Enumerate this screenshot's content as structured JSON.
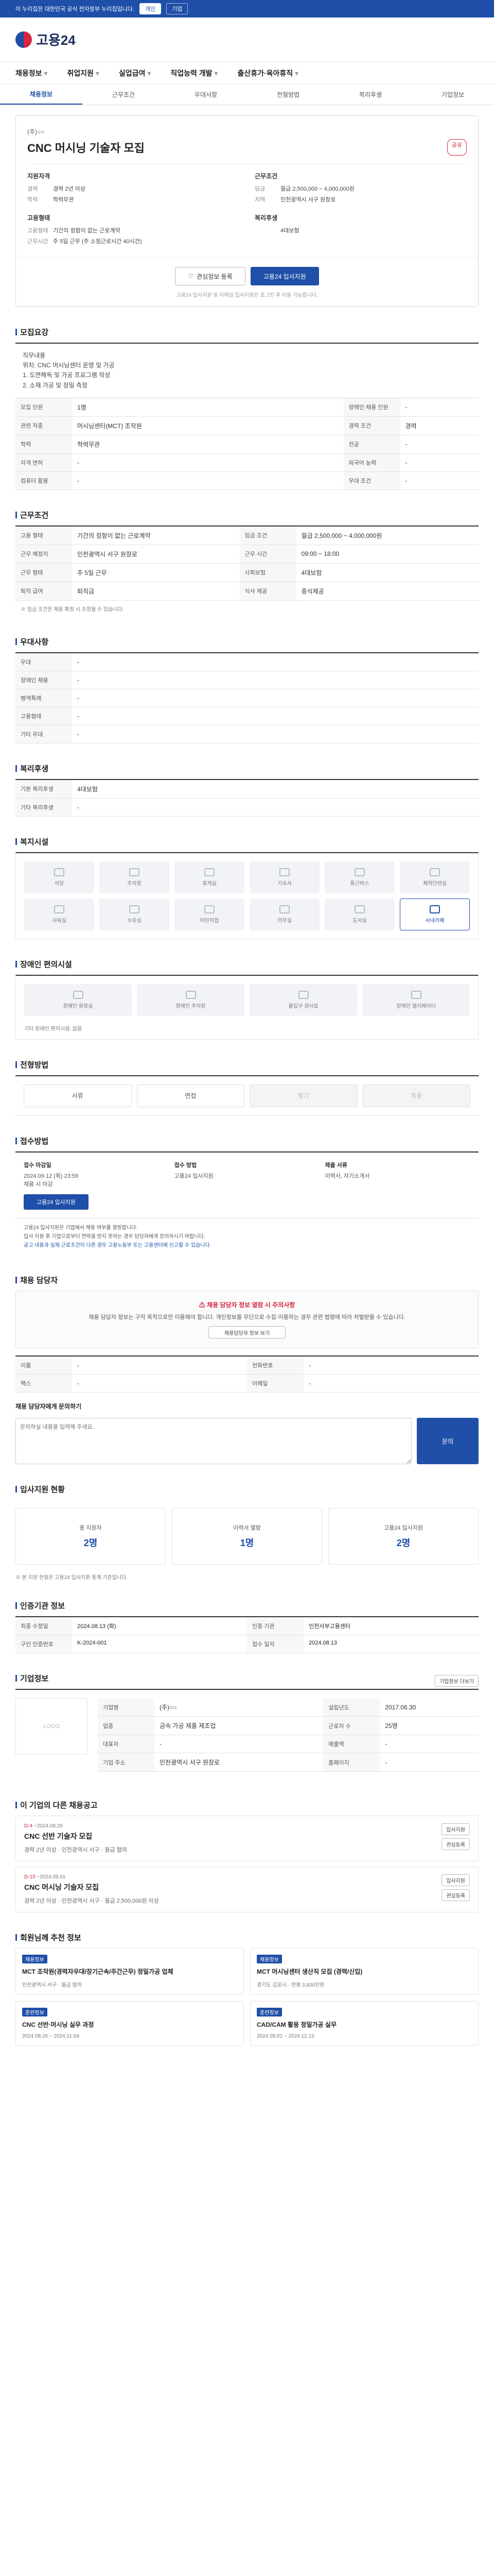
{
  "topbar": {
    "notice": "이 누리집은 대한민국 공식 전자정부 누리집입니다.",
    "tabs": [
      "개인",
      "기업"
    ]
  },
  "header": {
    "logo": "고용24"
  },
  "gnb": [
    "채용정보",
    "취업지원",
    "실업급여",
    "직업능력 개발",
    "출산휴가·육아휴직"
  ],
  "subtabs": [
    "채용정보",
    "근무조건",
    "우대사항",
    "전형방법",
    "복리후생",
    "기업정보"
  ],
  "job": {
    "company": "(주)○○",
    "title": "CNC 머시닝 기술자 모집",
    "share": "공유",
    "qual_title": "지원자격",
    "qual": [
      {
        "k": "경력",
        "v": "경력 2년 이상"
      },
      {
        "k": "학력",
        "v": "학력무관"
      }
    ],
    "cond_title": "근무조건",
    "cond": [
      {
        "k": "임금",
        "v": "월급 2,500,000 ~ 4,000,000원"
      },
      {
        "k": "지역",
        "v": "인천광역시 서구 원창로"
      }
    ],
    "form_title": "고용형태",
    "form": [
      {
        "k": "고용형태",
        "v": "기간의 정함이 없는 근로계약"
      },
      {
        "k": "근무시간",
        "v": "주 5일 근무 (주 소정근로시간 40시간)"
      }
    ],
    "welfare_title": "복리후생",
    "welfare": [
      {
        "k": "",
        "v": "4대보험"
      }
    ],
    "btn_interest": "관심정보 등록",
    "btn_apply": "고용24 입사지원",
    "note": "고용24 입사지원 및 이메일 입사지원은 로그인 후 이용 가능합니다."
  },
  "sec_recruit": {
    "title": "모집요강",
    "desc": "직무내용\n위치: CNC 머시닝센터 운영 및 가공\n1. 도면해독 및 가공 프로그램 작성\n2. 소재 가공 및 정밀 측정",
    "rows": [
      [
        "모집 인원",
        "1명",
        "장애인 채용 인원",
        "-"
      ],
      [
        "관련 직종",
        "머시닝센터(MCT) 조작원",
        "경력 조건",
        "경력"
      ],
      [
        "학력",
        "학력무관",
        "전공",
        "-"
      ],
      [
        "자격 면허",
        "-",
        "외국어 능력",
        "-"
      ],
      [
        "컴퓨터 활용",
        "-",
        "우대 조건",
        "-"
      ]
    ]
  },
  "sec_cond": {
    "title": "근무조건",
    "rows": [
      [
        "고용 형태",
        "기간의 정함이 없는 근로계약",
        "임금 조건",
        "월급 2,500,000 ~ 4,000,000원"
      ],
      [
        "근무 예정지",
        "인천광역시 서구 원창로",
        "근무 시간",
        "09:00 ~ 18:00"
      ],
      [
        "근무 형태",
        "주 5일 근무",
        "사회보험",
        "4대보험"
      ],
      [
        "퇴직 급여",
        "퇴직금",
        "식사 제공",
        "중식제공"
      ]
    ],
    "footnote": "※ 임금 조건은 채용 확정 시 조정될 수 있습니다."
  },
  "sec_pref": {
    "title": "우대사항",
    "rows": [
      [
        "우대",
        "-"
      ],
      [
        "장애인 채용",
        "-"
      ],
      [
        "병역특례",
        "-"
      ],
      [
        "고용형태",
        "-"
      ],
      [
        "기타 우대",
        "-"
      ]
    ]
  },
  "sec_welfare": {
    "title": "복리후생",
    "rows": [
      [
        "기본 복리후생",
        "4대보험"
      ],
      [
        "기타 복리후생",
        "-"
      ]
    ]
  },
  "sec_facility": {
    "title": "복지시설",
    "items": [
      "식당",
      "주차장",
      "휴게실",
      "기숙사",
      "통근버스",
      "체력단련실",
      "샤워실",
      "수유실",
      "어린이집",
      "의무실",
      "도서실",
      "사내카페"
    ]
  },
  "sec_disabled": {
    "title": "장애인 편의시설",
    "items": [
      "장애인 화장실",
      "장애인 주차장",
      "출입구 경사로",
      "장애인 엘리베이터"
    ],
    "note": "기타 장애인 편의시설: 없음"
  },
  "sec_process": {
    "title": "전형방법",
    "rows": [
      [
        "전형 방법",
        "서류",
        "면접"
      ],
      [
        "제출 서류",
        "이력서",
        "-"
      ]
    ],
    "steps": [
      "서류",
      "면접",
      "필기",
      "최종"
    ],
    "steps_off": [
      false,
      false,
      true,
      true
    ]
  },
  "sec_apply": {
    "title": "접수방법",
    "col1_h": "접수 마감일",
    "col1_v": "2024.09.12 (목) 23:59",
    "col1_note": "채용 시 마감",
    "col2_h": "접수 방법",
    "col2_v": "고용24 입사지원",
    "col3_h": "제출 서류",
    "col3_v": "이력서, 자기소개서",
    "apply_btn": "고용24 입사지원",
    "bullets": [
      "고용24 입사지원은 기업에서 채용 여부를 결정합니다.",
      "입사 지원 후 기업으로부터 연락을 받지 못하는 경우 담당자에게 문의하시기 바랍니다.",
      "공고 내용과 실제 근로조건이 다른 경우 고용노동부 또는 고용센터에 신고할 수 있습니다."
    ]
  },
  "sec_contact": {
    "title": "채용 담당자",
    "warn": "채용 담당자 정보 열람 시 주의사항",
    "warntext": "채용 담당자 정보는 구직 목적으로만 이용해야 합니다. 개인정보를 무단으로 수집·이용하는 경우 관련 법령에 따라 처벌받을 수 있습니다.",
    "linkbtn": "채용담당자 정보 보기",
    "rows": [
      [
        "이름",
        "-",
        "전화번호",
        "-"
      ],
      [
        "팩스",
        "-",
        "이메일",
        "-"
      ]
    ],
    "inquiry_label": "채용 담당자에게 문의하기",
    "inquiry_placeholder": "문의하실 내용을 입력해 주세요.",
    "send": "문의"
  },
  "sec_stats": {
    "title": "입사지원 현황",
    "items": [
      {
        "label": "총 지원자",
        "value": "2명"
      },
      {
        "label": "이력서 열람",
        "value": "1명"
      },
      {
        "label": "고용24 입사지원",
        "value": "2명"
      }
    ],
    "note": "※ 본 지원 현황은 고용24 입사지원 통계 기준입니다."
  },
  "sec_info": {
    "title": "인증기관 정보",
    "rows": [
      [
        "최종 수정일",
        "2024.08.13 (화)",
        "인증 기관",
        "인천서부고용센터"
      ],
      [
        "구인 인증번호",
        "K-2024-001",
        "접수 일자",
        "2024.08.13"
      ]
    ]
  },
  "sec_company": {
    "title": "기업정보",
    "logo": "LOGO",
    "rows": [
      [
        "기업명",
        "(주)○○",
        "설립년도",
        "2017.06.30"
      ],
      [
        "업종",
        "금속 가공 제품 제조업",
        "근로자 수",
        "25명"
      ],
      [
        "대표자",
        "-",
        "매출액",
        "-"
      ],
      [
        "기업 주소",
        "인천광역시 서구 원창로",
        "홈페이지",
        "-"
      ]
    ],
    "btn": "기업정보 더보기"
  },
  "sec_jobs": {
    "title": "이 기업의 다른 채용공고",
    "items": [
      {
        "dday": "D-4",
        "date": "~2024.08.26",
        "title": "CNC 선반 기술자 모집",
        "meta": "경력 2년 이상 · 인천광역시 서구 · 월급 협의"
      },
      {
        "dday": "D-10",
        "date": "~2024.09.01",
        "title": "CNC 머시닝 기술자 모집",
        "meta": "경력 2년 이상 · 인천광역시 서구 · 월급 2,500,000원 이상"
      }
    ],
    "btn_apply": "입사지원",
    "btn_interest": "관심등록"
  },
  "sec_rec": {
    "title": "회원님께 추천 정보",
    "items": [
      {
        "tag": "채용정보",
        "title": "MCT 조작원(경력자우대/장기근속/주간근무) 정밀가공 업체",
        "meta": "인천광역시 서구 · 월급 협의"
      },
      {
        "tag": "채용정보",
        "title": "MCT 머시닝센터 생산직 모집 (경력/신입)",
        "meta": "경기도 김포시 · 연봉 3,600만원"
      },
      {
        "tag": "훈련정보",
        "title": "CNC 선반·머시닝 실무 과정",
        "meta": "2024.08.26 ~ 2024.11.04"
      },
      {
        "tag": "훈련정보",
        "title": "CAD/CAM 활용 정밀가공 실무",
        "meta": "2024.09.02 ~ 2024.12.13"
      }
    ]
  }
}
